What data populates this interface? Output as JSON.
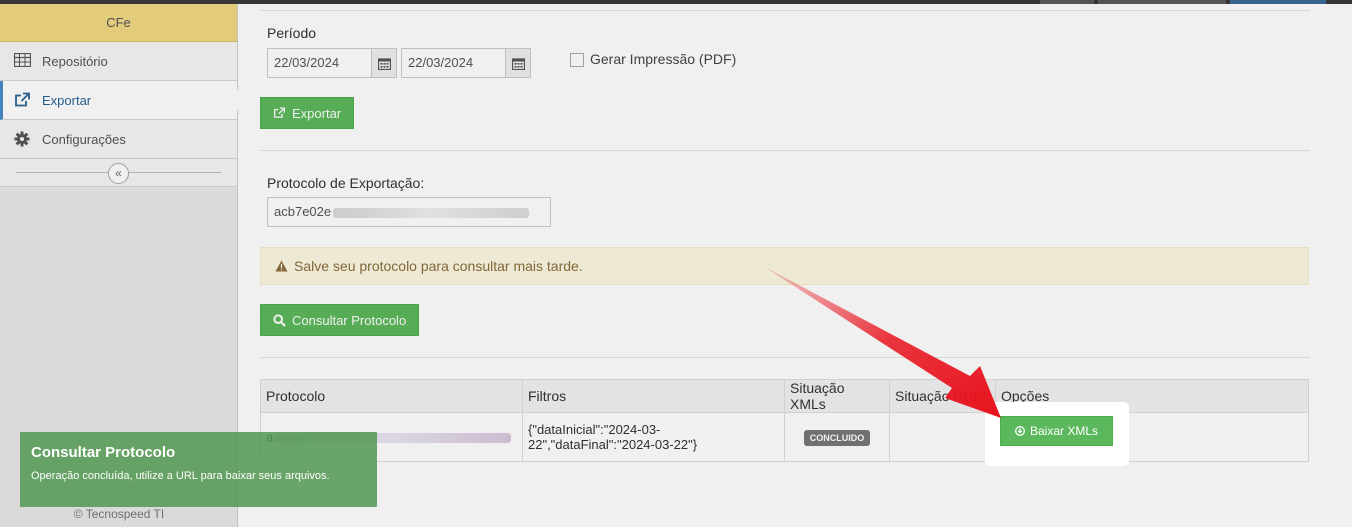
{
  "sidebar": {
    "brand": "CFe",
    "items": [
      {
        "label": "Repositório",
        "icon": "table-icon"
      },
      {
        "label": "Exportar",
        "icon": "external-link-icon",
        "active": true
      },
      {
        "label": "Configurações",
        "icon": "gear-icon"
      }
    ],
    "collapse_icon": "«",
    "copyright": "© Tecnospeed TI"
  },
  "export_form": {
    "period_label": "Período",
    "date_from": "22/03/2024",
    "date_to": "22/03/2024",
    "pdf_label": "Gerar Impressão (PDF)",
    "export_button": "Exportar",
    "protocol_label": "Protocolo de Exportação:",
    "protocol_value": "acb7e02e",
    "alert_text": "Salve seu protocolo para consultar mais tarde.",
    "consult_button": "Consultar Protocolo"
  },
  "table": {
    "headers": [
      "Protocolo",
      "Filtros",
      "Situação XMLs",
      "Situação PDFs",
      "Opções"
    ],
    "rows": [
      {
        "protocolo": "a",
        "filtros_line1": "{\"dataInicial\":\"2024-03-",
        "filtros_line2": "22\",\"dataFinal\":\"2024-03-22\"}",
        "situacao_xml": "CONCLUIDO",
        "situacao_pdf": "",
        "download_button": "Baixar XMLs"
      }
    ]
  },
  "toast": {
    "title": "Consultar Protocolo",
    "message": "Operação concluída, utilize a URL para baixar seus arquivos."
  },
  "colors": {
    "green": "#5cb85c",
    "arrow": "#e8141e",
    "alert_bg": "#fcf8e3",
    "brand_bg": "#f1d984"
  }
}
